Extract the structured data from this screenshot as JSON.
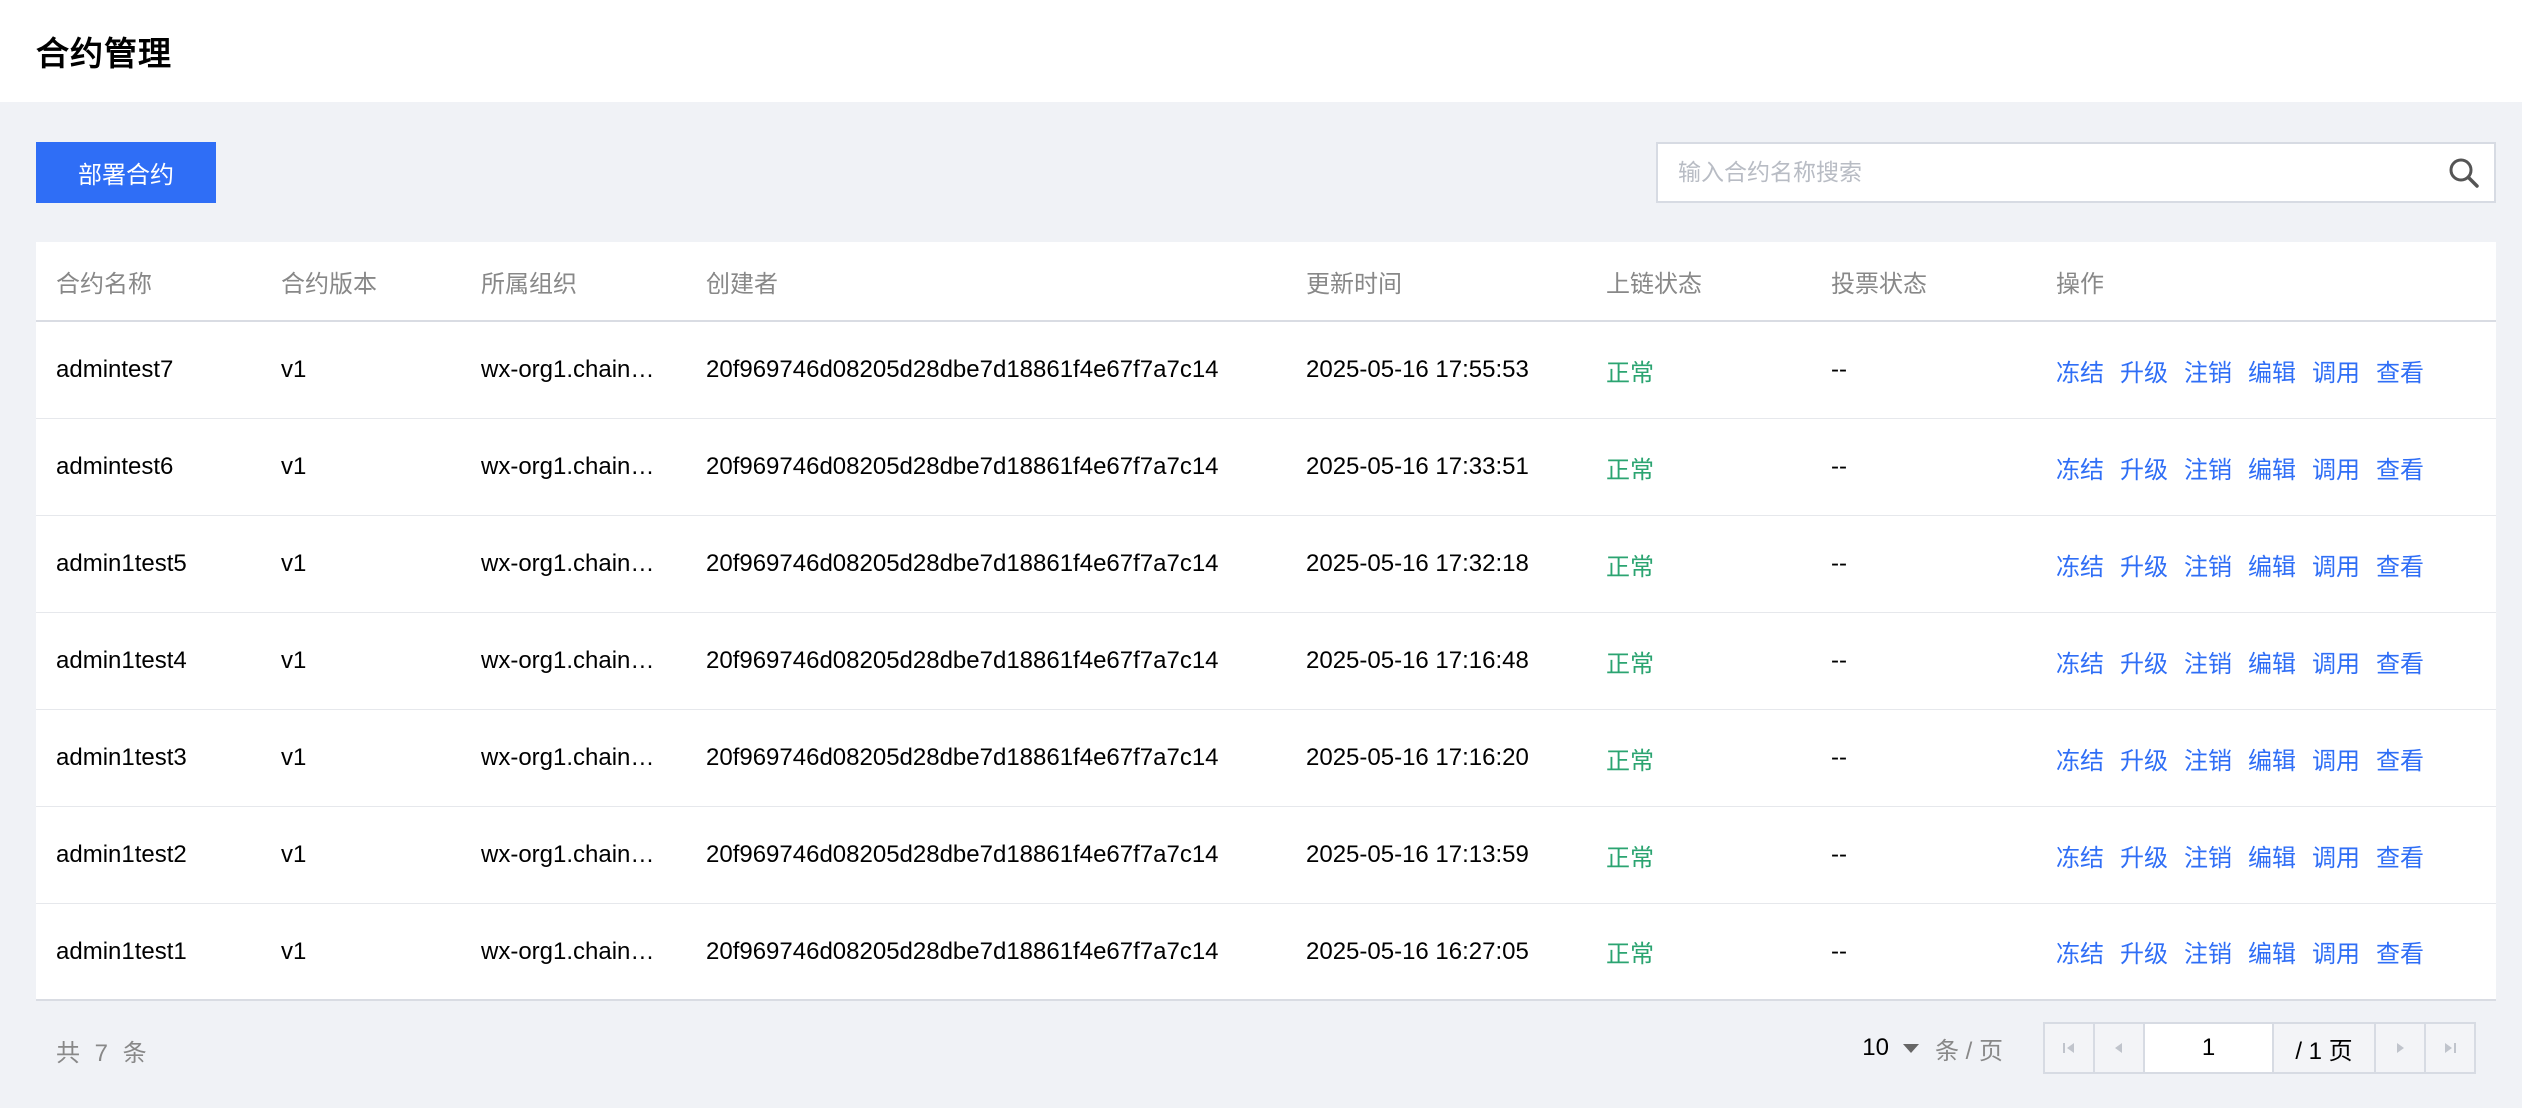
{
  "page": {
    "title": "合约管理"
  },
  "toolbar": {
    "deploy_label": "部署合约",
    "search_placeholder": "输入合约名称搜索"
  },
  "table": {
    "headers": [
      "合约名称",
      "合约版本",
      "所属组织",
      "创建者",
      "更新时间",
      "上链状态",
      "投票状态",
      "操作"
    ],
    "rows": [
      {
        "name": "admintest7",
        "version": "v1",
        "org": "wx-org1.chain…",
        "creator": "20f969746d08205d28dbe7d18861f4e67f7a7c14",
        "updated": "2025-05-16 17:55:53",
        "status": "正常",
        "vote": "--"
      },
      {
        "name": "admintest6",
        "version": "v1",
        "org": "wx-org1.chain…",
        "creator": "20f969746d08205d28dbe7d18861f4e67f7a7c14",
        "updated": "2025-05-16 17:33:51",
        "status": "正常",
        "vote": "--"
      },
      {
        "name": "admin1test5",
        "version": "v1",
        "org": "wx-org1.chain…",
        "creator": "20f969746d08205d28dbe7d18861f4e67f7a7c14",
        "updated": "2025-05-16 17:32:18",
        "status": "正常",
        "vote": "--"
      },
      {
        "name": "admin1test4",
        "version": "v1",
        "org": "wx-org1.chain…",
        "creator": "20f969746d08205d28dbe7d18861f4e67f7a7c14",
        "updated": "2025-05-16 17:16:48",
        "status": "正常",
        "vote": "--"
      },
      {
        "name": "admin1test3",
        "version": "v1",
        "org": "wx-org1.chain…",
        "creator": "20f969746d08205d28dbe7d18861f4e67f7a7c14",
        "updated": "2025-05-16 17:16:20",
        "status": "正常",
        "vote": "--"
      },
      {
        "name": "admin1test2",
        "version": "v1",
        "org": "wx-org1.chain…",
        "creator": "20f969746d08205d28dbe7d18861f4e67f7a7c14",
        "updated": "2025-05-16 17:13:59",
        "status": "正常",
        "vote": "--"
      },
      {
        "name": "admin1test1",
        "version": "v1",
        "org": "wx-org1.chain…",
        "creator": "20f969746d08205d28dbe7d18861f4e67f7a7c14",
        "updated": "2025-05-16 16:27:05",
        "status": "正常",
        "vote": "--"
      }
    ],
    "actions": [
      "冻结",
      "升级",
      "注销",
      "编辑",
      "调用",
      "查看"
    ]
  },
  "pagination": {
    "total_text": "共 7 条",
    "page_size": "10",
    "per_page_label": "条 / 页",
    "current_page": "1",
    "total_pages_text": "/ 1 页"
  },
  "colors": {
    "primary": "#2f6ef6",
    "status_ok": "#2ba471",
    "background": "#f0f2f6"
  },
  "icons": {
    "search": "search-icon",
    "first": "first-page-icon",
    "prev": "prev-page-icon",
    "next": "next-page-icon",
    "last": "last-page-icon",
    "dropdown": "chevron-down-icon"
  }
}
